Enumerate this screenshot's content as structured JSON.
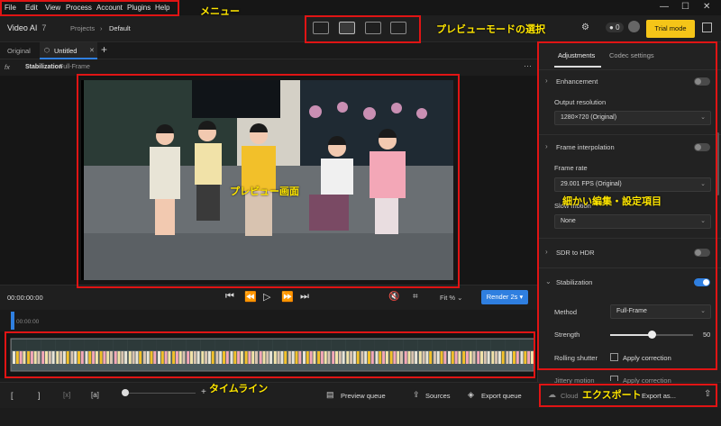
{
  "menu": [
    "File",
    "Edit",
    "View",
    "Process",
    "Account",
    "Plugins",
    "Help"
  ],
  "header": {
    "app_name": "Video AI",
    "app_version": "7",
    "breadcrumb": [
      "Projects",
      "Default"
    ],
    "credits": "0",
    "trial_label": "Trial mode"
  },
  "tabs": {
    "original": "Original",
    "current": "Untitled"
  },
  "toolbar": {
    "fx": "fx",
    "filter_name": "Stabilization",
    "filter_mode": "Full-Frame"
  },
  "transport": {
    "timecode": "00:00:00:00",
    "fit": "Fit %",
    "render": "Render 2s"
  },
  "ruler": {
    "start": "00:00:00"
  },
  "bottom": {
    "in_mark": "[",
    "out_mark": "]",
    "preview_queue": "Preview queue",
    "sources": "Sources",
    "export_queue": "Export queue",
    "cloud": "Cloud",
    "export_as": "Export as..."
  },
  "panel": {
    "tabs": [
      "Adjustments",
      "Codec settings"
    ],
    "enhancement": "Enhancement",
    "output_resolution": "Output resolution",
    "output_resolution_value": "1280×720 (Original)",
    "frame_interpolation": "Frame interpolation",
    "frame_rate": "Frame rate",
    "frame_rate_value": "29.001 FPS (Original)",
    "slow_motion": "Slow motion",
    "slow_motion_value": "None",
    "sdr_to_hdr": "SDR to HDR",
    "stabilization": "Stabilization",
    "method": "Method",
    "method_value": "Full-Frame",
    "strength": "Strength",
    "strength_value": "50",
    "strength_level": 0.5,
    "rolling_shutter": "Rolling shutter",
    "apply_correction": "Apply correction",
    "jittery_motion": "Jittery motion",
    "apply_correction2": "Apply correction"
  },
  "annotations": {
    "menu": "メニュー",
    "preview_mode": "プレビューモードの選択",
    "preview_screen": "プレビュー画面",
    "settings": "細かい編集・設定項目",
    "timeline": "タイムライン",
    "export": "エクスポート"
  },
  "colors": {
    "accent": "#2f7fe0",
    "trial": "#f5c518",
    "annotation_box": "#e01414",
    "annotation_text": "#ffe600"
  }
}
